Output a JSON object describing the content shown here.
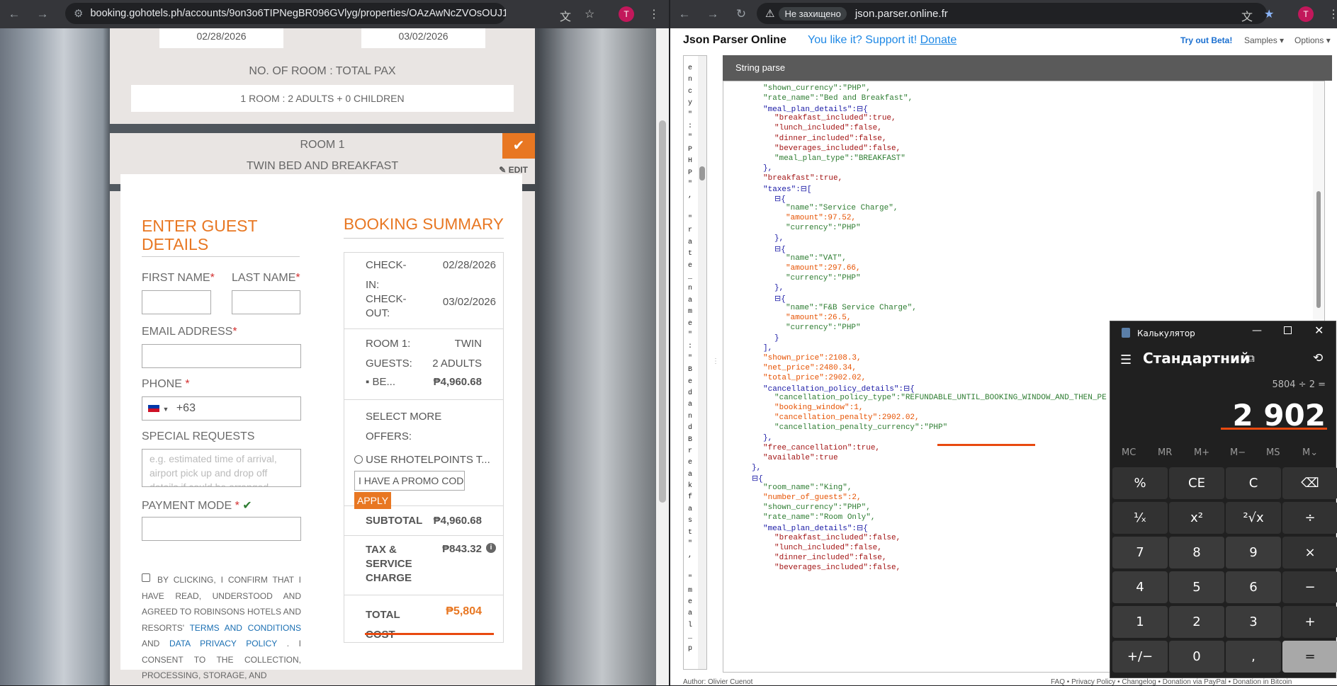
{
  "left_browser": {
    "url": "booking.gohotels.ph/accounts/9on3o6TIPNegBR096GVlyg/properties/OAzAwNcZVOsOUJ1aSTLaBQ/b...",
    "avatar": "T",
    "icons": [
      "back-icon",
      "forward-icon",
      "reload-icon",
      "site-settings-icon",
      "translate-icon",
      "bookmark-star-icon",
      "menu-dots-icon"
    ]
  },
  "booking": {
    "checkin_date": "02/28/2026",
    "checkout_date": "03/02/2026",
    "room_pax_label": "NO. OF ROOM : TOTAL PAX",
    "room_pax_value": "1 ROOM : 2 ADULTS + 0 CHILDREN",
    "room_title": "ROOM 1",
    "room_type": "TWIN BED AND BREAKFAST",
    "edit_label": "EDIT",
    "guest_title_1": "ENTER GUEST",
    "guest_title_2": "DETAILS",
    "first_name_label": "FIRST NAME",
    "last_name_label": "LAST NAME",
    "email_label": "EMAIL ADDRESS",
    "phone_label": "PHONE",
    "phone_code": "+63",
    "special_label": "SPECIAL REQUESTS",
    "special_placeholder": "e.g. estimated time of arrival, airport pick up and drop off details if could be arranged",
    "payment_label": "PAYMENT MODE",
    "required_mark": "*",
    "consent_lines": [
      "BY CLICKING, I CONFIRM THAT I",
      "HAVE READ, UNDERSTOOD AND",
      "AGREED TO ROBINSONS HOTELS AND",
      "RESORTS'",
      "TERMS AND CONDITIONS",
      "AND",
      "DATA PRIVACY POLICY",
      ". I",
      "CONSENT TO THE COLLECTION,",
      "PROCESSING, STORAGE, AND"
    ]
  },
  "summary": {
    "title": "BOOKING SUMMARY",
    "checkin_label_1": "CHECK-",
    "checkin_label_2": "IN:",
    "checkin_value": "02/28/2026",
    "checkout_label_1": "CHECK-",
    "checkout_label_2": "OUT:",
    "checkout_value": "03/02/2026",
    "room_label": "ROOM 1:",
    "room_value": "TWIN",
    "guests_label": "GUESTS:",
    "guests_value": "2 ADULTS",
    "be_label": "▪ BE...",
    "room_price": "₱4,960.68",
    "offers_1": "SELECT MORE",
    "offers_2": "OFFERS:",
    "rhotel_label": "USE RHOTELPOINTS T...",
    "promo_placeholder": "I HAVE A PROMO CODE",
    "apply_label": "APPLY",
    "subtotal_label": "SUBTOTAL",
    "subtotal_value": "₱4,960.68",
    "tax_label_1": "TAX &",
    "tax_label_2": "SERVICE",
    "tax_label_3": "CHARGE",
    "tax_value": "₱843.32",
    "total_label_1": "TOTAL",
    "total_label_2": "COST",
    "total_value": "₱5,804"
  },
  "right_browser": {
    "insecure_label": "Не захищено",
    "url": "json.parser.online.fr",
    "avatar": "T"
  },
  "json_parser": {
    "brand": "Json Parser Online",
    "support_text": "You like it? Support it!",
    "donate_label": "Donate",
    "beta_label": "Try out Beta!",
    "samples_label": "Samples ▾",
    "options_label": "Options ▾",
    "panel_title": "String parse",
    "vertical_chars": [
      "e",
      "n",
      "c",
      "y",
      "\"",
      ":",
      "\"",
      "P",
      "H",
      "P",
      "\"",
      ",",
      "",
      "\"",
      "r",
      "a",
      "t",
      "e",
      "_",
      "n",
      "a",
      "m",
      "e",
      "\"",
      ":",
      "\"",
      "B",
      "e",
      "d",
      "a",
      "n",
      "d",
      "B",
      "r",
      "e",
      "a",
      "k",
      "f",
      "a",
      "s",
      "t",
      "\"",
      ",",
      "",
      "\"",
      "m",
      "e",
      "a",
      "l",
      "_",
      "p"
    ],
    "lines": [
      {
        "i": 3,
        "t": "\"shown_currency\":\"PHP\","
      },
      {
        "i": 3,
        "t": "\"rate_name\":\"Bed and Breakfast\","
      },
      {
        "i": 3,
        "t": "\"meal_plan_details\":⊟{"
      },
      {
        "i": 4,
        "t": "\"breakfast_included\":true,"
      },
      {
        "i": 4,
        "t": "\"lunch_included\":false,"
      },
      {
        "i": 4,
        "t": "\"dinner_included\":false,"
      },
      {
        "i": 4,
        "t": "\"beverages_included\":false,"
      },
      {
        "i": 4,
        "t": "\"meal_plan_type\":\"BREAKFAST\""
      },
      {
        "i": 3,
        "t": "},"
      },
      {
        "i": 3,
        "t": "\"breakfast\":true,"
      },
      {
        "i": 3,
        "t": "\"taxes\":⊟["
      },
      {
        "i": 4,
        "t": "⊟{"
      },
      {
        "i": 5,
        "t": "\"name\":\"Service Charge\","
      },
      {
        "i": 5,
        "t": "\"amount\":97.52,"
      },
      {
        "i": 5,
        "t": "\"currency\":\"PHP\""
      },
      {
        "i": 4,
        "t": "},"
      },
      {
        "i": 4,
        "t": "⊟{"
      },
      {
        "i": 5,
        "t": "\"name\":\"VAT\","
      },
      {
        "i": 5,
        "t": "\"amount\":297.66,"
      },
      {
        "i": 5,
        "t": "\"currency\":\"PHP\""
      },
      {
        "i": 4,
        "t": "},"
      },
      {
        "i": 4,
        "t": "⊟{"
      },
      {
        "i": 5,
        "t": "\"name\":\"F&B Service Charge\","
      },
      {
        "i": 5,
        "t": "\"amount\":26.5,"
      },
      {
        "i": 5,
        "t": "\"currency\":\"PHP\""
      },
      {
        "i": 4,
        "t": "}"
      },
      {
        "i": 3,
        "t": "],"
      },
      {
        "i": 3,
        "t": "\"shown_price\":2108.3,"
      },
      {
        "i": 3,
        "t": "\"net_price\":2480.34,"
      },
      {
        "i": 3,
        "t": "\"total_price\":2902.02,"
      },
      {
        "i": 3,
        "t": "\"cancellation_policy_details\":⊟{"
      },
      {
        "i": 4,
        "t": "\"cancellation_policy_type\":\"REFUNDABLE_UNTIL_BOOKING_WINDOW_AND_THEN_PE"
      },
      {
        "i": 4,
        "t": "\"booking_window\":1,"
      },
      {
        "i": 4,
        "t": "\"cancellation_penalty\":2902.02,"
      },
      {
        "i": 4,
        "t": "\"cancellation_penalty_currency\":\"PHP\""
      },
      {
        "i": 3,
        "t": "},"
      },
      {
        "i": 3,
        "t": "\"free_cancellation\":true,"
      },
      {
        "i": 3,
        "t": "\"available\":true"
      },
      {
        "i": 2,
        "t": "},"
      },
      {
        "i": 2,
        "t": "⊟{"
      },
      {
        "i": 3,
        "t": "\"room_name\":\"King\","
      },
      {
        "i": 3,
        "t": "\"number_of_guests\":2,"
      },
      {
        "i": 3,
        "t": "\"shown_currency\":\"PHP\","
      },
      {
        "i": 3,
        "t": "\"rate_name\":\"Room Only\","
      },
      {
        "i": 3,
        "t": "\"meal_plan_details\":⊟{"
      },
      {
        "i": 4,
        "t": "\"breakfast_included\":false,"
      },
      {
        "i": 4,
        "t": "\"lunch_included\":false,"
      },
      {
        "i": 4,
        "t": "\"dinner_included\":false,"
      },
      {
        "i": 4,
        "t": "\"beverages_included\":false,"
      }
    ],
    "footer_author": "Author: Olivier Cuenot",
    "footer_links": "FAQ  •  Privacy Policy  •  Changelog  •  Donation via PayPal  •  Donation in Bitcoin"
  },
  "calculator": {
    "title": "Калькулятор",
    "mode": "Стандартний",
    "expression": "5804 ÷ 2 =",
    "result": "2 902",
    "memory": [
      "MC",
      "MR",
      "M+",
      "M−",
      "MS",
      "M⌄"
    ],
    "keys": [
      "%",
      "CE",
      "C",
      "⌫",
      "¹⁄ₓ",
      "x²",
      "²√x",
      "÷",
      "7",
      "8",
      "9",
      "×",
      "4",
      "5",
      "6",
      "−",
      "1",
      "2",
      "3",
      "+",
      "+/−",
      "0",
      ",",
      "="
    ]
  }
}
